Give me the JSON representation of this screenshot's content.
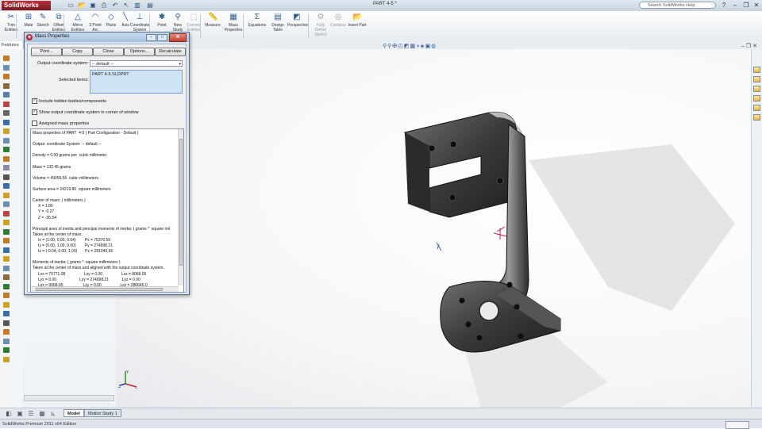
{
  "app": {
    "logo": "SolidWorks",
    "document_title": "PART  4-5 *",
    "search_placeholder": "Search SolidWorks Help",
    "edition": "SolidWorks Premium 2011 x64 Edition"
  },
  "commands": [
    {
      "label": "Trim Entities",
      "icon": "trim-icon",
      "glyph": "✂",
      "enabled": true
    },
    {
      "label": "Mate",
      "icon": "mate-icon",
      "glyph": "⊞",
      "enabled": true
    },
    {
      "label": "Sketch",
      "icon": "sketch-icon",
      "glyph": "✎",
      "enabled": true
    },
    {
      "label": "Offset Entities",
      "icon": "offset-icon",
      "glyph": "⧉",
      "enabled": true
    },
    {
      "label": "Mirror Entities",
      "icon": "mirror-icon",
      "glyph": "△",
      "enabled": true
    },
    {
      "label": "3 Point Arc",
      "icon": "arc-icon",
      "glyph": "◠",
      "enabled": true
    },
    {
      "label": "Plane",
      "icon": "plane-icon",
      "glyph": "◇",
      "enabled": true
    },
    {
      "label": "Axis",
      "icon": "axis-icon",
      "glyph": "╲",
      "enabled": true
    },
    {
      "label": "Coordinate System",
      "icon": "coordinate-system-icon",
      "glyph": "⊥",
      "enabled": true
    },
    {
      "label": "Point",
      "icon": "point-icon",
      "glyph": "✱",
      "enabled": true
    },
    {
      "label": "New Study",
      "icon": "new-study-icon",
      "glyph": "⚲",
      "enabled": true
    },
    {
      "label": "Convert Entities",
      "icon": "convert-icon",
      "glyph": "⬚",
      "enabled": false
    },
    {
      "label": "Measure",
      "icon": "measure-icon",
      "glyph": "📏",
      "enabled": true
    },
    {
      "label": "Mass Properties",
      "icon": "mass-properties-icon",
      "glyph": "▦",
      "enabled": true
    },
    {
      "label": "Equations",
      "icon": "equations-icon",
      "glyph": "Σ",
      "enabled": true
    },
    {
      "label": "Design Table",
      "icon": "design-table-icon",
      "glyph": "▤",
      "enabled": true
    },
    {
      "label": "Perspective",
      "icon": "perspective-icon",
      "glyph": "◩",
      "enabled": true
    },
    {
      "label": "Fully Define Sketch",
      "icon": "fully-define-icon",
      "glyph": "⚙",
      "enabled": false
    },
    {
      "label": "Combine",
      "icon": "combine-icon",
      "glyph": "◎",
      "enabled": false
    },
    {
      "label": "Insert Part",
      "icon": "insert-part-icon",
      "glyph": "📂",
      "enabled": true
    }
  ],
  "feature_tab": "Features",
  "dialog": {
    "title": "Mass Properties",
    "buttons": {
      "print": "Print...",
      "copy": "Copy",
      "close": "Close",
      "options": "Options...",
      "recalculate": "Recalculate"
    },
    "output_cs_label": "Output coordinate system:",
    "output_cs_value": "-- default --",
    "selected_items_label": "Selected items:",
    "selected_item": "PART  4-5.SLDPRT",
    "checkboxes": [
      {
        "label": "Include hidden bodies/components",
        "checked": true
      },
      {
        "label": "Show output coordinate system in corner of window",
        "checked": true
      },
      {
        "label": "Assigned mass properties",
        "checked": false
      }
    ],
    "results": [
      "Mass properties of PART  4-5 ( Part Configuration - Default )",
      "",
      "Output  coordinate System: -- default --",
      "",
      "Density = 0.00 grams per  cubic millimeter",
      "",
      "Mass = 132.45 grams",
      "",
      "Volume = 49055.56  cubic millimeters",
      "",
      "Surface area = 24219.80  square millimeters",
      "",
      "Center of mass: ( millimeters )",
      "     X = 1.80",
      "     Y = -0.27",
      "     Z = -35.54",
      "",
      "Principal axes of inertia and principal moments of inertia: ( grams *  square mil",
      "Taken at the center of mass.",
      "     Ix = (1.00, 0.00, 0.04)        Px = 75370.50",
      "     Iy = (0.00, 1.00, 0.00)        Py = 274998.21",
      "     Iz = (-0.04, 0.00, 1.00)       Pz = 281046.66",
      "",
      "Moments of inertia: ( grams *  square millimeters )",
      "Taken at the center of mass and aligned with the output coordinate system.",
      "     Lxx = 75771.08                 Lxy = 0.00                 Lxz = 8068.05",
      "     Lyx = 0.00                     Lyy = 274998.21            Lyz = 0.00",
      "     Lzx = 9068.05                  Lzy = 0.00                 Lzz = 280646.0"
    ]
  },
  "bottom_tabs": [
    "Model",
    "Motion Study 1"
  ]
}
